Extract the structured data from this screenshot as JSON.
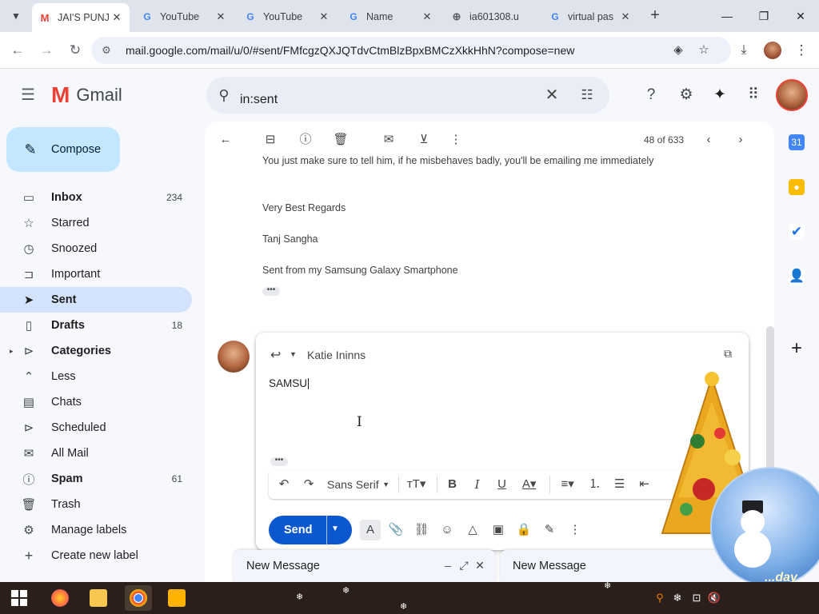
{
  "browser": {
    "tabs": [
      {
        "title": "JAI'S PUNJ",
        "favicon": "gmail-icon",
        "active": true
      },
      {
        "title": "YouTube",
        "favicon": "google-icon",
        "active": false
      },
      {
        "title": "YouTube",
        "favicon": "google-icon",
        "active": false
      },
      {
        "title": "Name",
        "favicon": "google-icon",
        "active": false
      },
      {
        "title": "ia601308.u",
        "favicon": "globe-icon",
        "active": false
      },
      {
        "title": "virtual pas",
        "favicon": "google-icon",
        "active": false
      }
    ],
    "url": "mail.google.com/mail/u/0/#sent/FMfcgzQXJQTdvCtmBlzBpxBMCzXkkHhN?compose=new",
    "close_glyph": "✕",
    "newtab_glyph": "+"
  },
  "gmail": {
    "logo_text": "Gmail",
    "search_query": "in:sent",
    "compose_label": "Compose",
    "nav": [
      {
        "label": "Inbox",
        "count": "234",
        "bold": true,
        "icon": "inbox-icon",
        "glyph": "▭"
      },
      {
        "label": "Starred",
        "count": "",
        "bold": false,
        "icon": "star-icon",
        "glyph": "☆"
      },
      {
        "label": "Snoozed",
        "count": "",
        "bold": false,
        "icon": "clock-icon",
        "glyph": "◷"
      },
      {
        "label": "Important",
        "count": "",
        "bold": false,
        "icon": "important-icon",
        "glyph": "⊐"
      },
      {
        "label": "Sent",
        "count": "",
        "bold": true,
        "icon": "send-icon",
        "glyph": "➤",
        "active": true
      },
      {
        "label": "Drafts",
        "count": "18",
        "bold": true,
        "icon": "draft-icon",
        "glyph": "▯"
      },
      {
        "label": "Categories",
        "count": "",
        "bold": true,
        "icon": "label-icon",
        "glyph": "⊳",
        "expand": "▸"
      },
      {
        "label": "Less",
        "count": "",
        "bold": false,
        "icon": "chevron-up-icon",
        "glyph": "⌃"
      },
      {
        "label": "Chats",
        "count": "",
        "bold": false,
        "icon": "chat-icon",
        "glyph": "▤"
      },
      {
        "label": "Scheduled",
        "count": "",
        "bold": false,
        "icon": "scheduled-icon",
        "glyph": "⊳"
      },
      {
        "label": "All Mail",
        "count": "",
        "bold": false,
        "icon": "all-mail-icon",
        "glyph": "✉"
      },
      {
        "label": "Spam",
        "count": "61",
        "bold": true,
        "icon": "spam-icon",
        "glyph": "ⓘ"
      },
      {
        "label": "Trash",
        "count": "",
        "bold": false,
        "icon": "trash-icon",
        "glyph": "🗑"
      },
      {
        "label": "Manage labels",
        "count": "",
        "bold": false,
        "icon": "gear-icon",
        "glyph": "⚙"
      },
      {
        "label": "Create new label",
        "count": "",
        "bold": false,
        "icon": "plus-icon",
        "glyph": "+"
      }
    ],
    "pager": "48 of 633",
    "message_lines": [
      "You just make sure to tell him, if he misbehaves badly, you'll be emailing me immediately",
      "Very Best Regards",
      "Tanj Sangha",
      "Sent from my Samsung Galaxy Smartphone"
    ],
    "ellipsis": "•••",
    "reply": {
      "recipient": "Katie Ininns",
      "body": "SAMSU",
      "font": "Sans Serif",
      "send_label": "Send"
    },
    "drafts": [
      {
        "title": "New Message"
      },
      {
        "title": "New Message"
      }
    ]
  },
  "decoration": {
    "globe_text": "...day"
  }
}
